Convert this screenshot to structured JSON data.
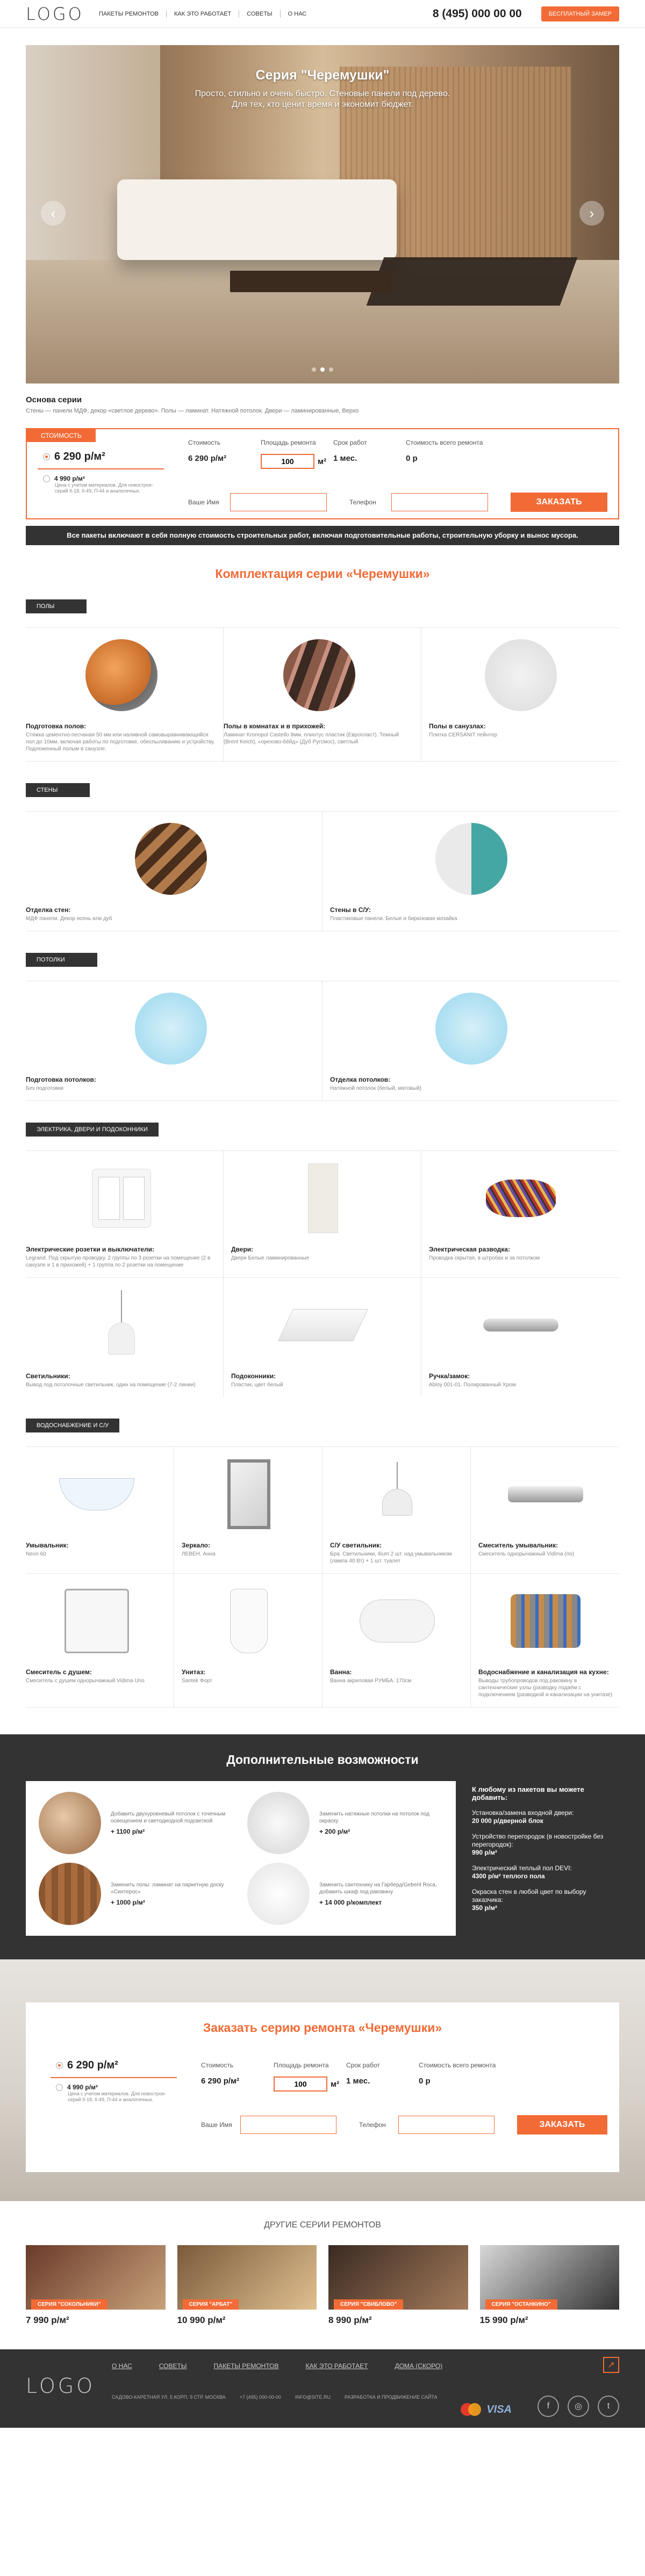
{
  "header": {
    "logo": "LOGO",
    "nav": [
      "Пакеты ремонтов",
      "Как это работает",
      "Советы",
      "О нас"
    ],
    "phone": "8 (495) 000 00 00",
    "cta": "Бесплатный замер"
  },
  "hero": {
    "title": "Серия \"Черемушки\"",
    "line1": "Просто, стильно и очень быстро. Стеновые панели под дерево.",
    "line2": "Для тех, кто ценит время и экономит бюджет.",
    "prev": "‹",
    "next": "›"
  },
  "series": {
    "title": "Основа серии",
    "desc": "Стены — панели МДФ, декор «светлое дерево». Полы — ламинат. Натяжной потолок. Двери — ламинированные, Верхо"
  },
  "calc": {
    "tab": "Стоимость",
    "price_main": "6 290 р/м²",
    "price_alt": "4 990 р/м²",
    "note_line1": "Цена с учетом материалов. Для новострое-",
    "note_line2": "серий II-18, II-49, П-44 и аналогичных.",
    "col1_label": "Стоимость",
    "col1_value": "6 290 р/м²",
    "col2_label": "Площадь ремонта",
    "col2_value": "100",
    "col2_unit": "м²",
    "col3_label": "Срок работ",
    "col3_value": "1 мес.",
    "col4_label": "Стоимость всего ремонта",
    "col4_value": "0 р",
    "name_label": "Ваше Имя",
    "phone_label": "Телефон",
    "order_button": "Заказать"
  },
  "banner": "Все пакеты включают в себя полную стоимость строительных работ, включая подготовительные работы, строительную уборку и вынос мусора.",
  "kit_title": "Комплектация серии «Черемушки»",
  "groups": {
    "floors": {
      "label": "Полы",
      "items": [
        {
          "title": "Подготовка полов:",
          "text": "Стяжка цементно-песчаная 50 мм или наливной самовыравнивающийся пол до 10мм, включая работы по подготовке, обеспыливанию и устройству. Подложенный полым в санузле."
        },
        {
          "title": "Полы в комнатах и в прихожей:",
          "text": "Ламинат Kronopol Castello 8мм, плинтус пластик (Европласт). Темный (Brent Keich), «орехово-бёйд» (Дуб Ругсмос), светлый"
        },
        {
          "title": "Полы в санузлах:",
          "text": "Плитка CERSANIT пейнтер"
        }
      ]
    },
    "walls": {
      "label": "Стены",
      "items": [
        {
          "title": "Отделка стен:",
          "text": "МДФ панели. Декор ясень или дуб"
        },
        {
          "title": "Стены в С/У:",
          "text": "Пластиковые панели. Белые и бирюзовая мозайка"
        }
      ]
    },
    "ceilings": {
      "label": "Потолки",
      "items": [
        {
          "title": "Подготовка потолков:",
          "text": "Без подготовки"
        },
        {
          "title": "Отделка потолков:",
          "text": "Натяжной потолок (белый, матовый)"
        }
      ]
    },
    "electric": {
      "label": "Электрика, двери и подоконники",
      "items": [
        {
          "title": "Электрические розетки и выключатели:",
          "text": "Legrand. Под скрытую проводку. 2 группы по 3 розетки на помещение (2 в санузле и 1 в прихожей) + 1 группа по 2 розетки на помещение"
        },
        {
          "title": "Двери:",
          "text": "Двери Белые ламинированные"
        },
        {
          "title": "Электрическая разводка:",
          "text": "Проводка скрытая, в штробах и за потолком"
        },
        {
          "title": "Светильники:",
          "text": "Вывод под потолочные светильник, один на помещение (7-2 линии)"
        },
        {
          "title": "Подоконники:",
          "text": "Пластик, цвет белый"
        },
        {
          "title": "Ручка/замок:",
          "text": "Abloy 001-01. Полированный Хром"
        }
      ]
    },
    "plumbing": {
      "label": "Водоснабжение и С/У",
      "items": [
        {
          "title": "Умывальник:",
          "text": "Neon 60"
        },
        {
          "title": "Зеркало:",
          "text": "ЛЕВЕН, Анна"
        },
        {
          "title": "С/У светильник:",
          "text": "Бра. Светильники, Ilium 2 шт. над умывальником (лампа 40 Вт) + 1 шт. туалет"
        },
        {
          "title": "Смеситель умывальник:",
          "text": "Смеситель однорычажный Vidima (по)"
        },
        {
          "title": "Смеситель с душем:",
          "text": "Смеситель с душем однорычажный Vidima Uno"
        },
        {
          "title": "Унитаз:",
          "text": "Santek Форт"
        },
        {
          "title": "Ванна:",
          "text": "Ванна акриловая РУМБА. 170см"
        },
        {
          "title": "Водоснабжение и канализация на кухне:",
          "text": "Выводы трубопроводов под раковину в сантехнические узлы (разводку подаём с подключением (разводкой и канализации на унитазе)"
        }
      ]
    }
  },
  "additional": {
    "title": "Дополнительные возможности",
    "items": [
      {
        "text": "Добавить двухуровневый потолок с точечным освещением и светодиодной подсветкой",
        "price": "+ 1100 р/м²"
      },
      {
        "text": "Заменить натяжные потолки на потолок под окраску",
        "price": "+ 200 р/м²"
      },
      {
        "text": "Заменить полы: ламинат на паркетную доску «Синтерос»",
        "price": "+ 1000 р/м²"
      },
      {
        "text": "Заменить сантехнику на Гарберд/Geberit Roca, добавить шкаф под раковину",
        "price": "+ 14 000 р/комплект"
      }
    ],
    "side_header": "К любому из пакетов вы можете добавить:",
    "side": [
      {
        "label": "Установка/замена входной двери:",
        "value": "20 000 р/дверной блок"
      },
      {
        "label": "Устройство перегородок (в новостройке без перегородок):",
        "value": "990 р/м²"
      },
      {
        "label": "Электрический теплый пол DEVI:",
        "value": "4300 р/м² теплого пола"
      },
      {
        "label": "Окраска стен в любой цвет по выбору заказчика:",
        "value": "350 р/м²"
      }
    ]
  },
  "order": {
    "title": "Заказать серию ремонта «Черемушки»"
  },
  "other": {
    "title": "Другие серии ремонтов",
    "cards": [
      {
        "badge": "Серия \"Сокольники\"",
        "price": "7 990 р/м²"
      },
      {
        "badge": "Серия \"Арбат\"",
        "price": "10 990 р/м²"
      },
      {
        "badge": "Серия \"Свиблово\"",
        "price": "8 990 р/м²"
      },
      {
        "badge": "Серия \"Останкино\"",
        "price": "15 990 р/м²"
      }
    ]
  },
  "footer": {
    "logo": "LOGO",
    "nav": [
      "О нас",
      "Советы",
      "Пакеты ремонтов",
      "Как это работает",
      "Дома (СКОРО)"
    ],
    "addr": [
      "САДОВО-КАРЕТНАЯ УЛ. 5 КОРП. 9 СТР. МОСКВА",
      "+7 (495) 000-00-00",
      "INFO@SITE.RU",
      "РАЗРАБОТКА И ПРОДВИЖЕНИЕ САЙТА"
    ],
    "up": "↗",
    "visa": "VISA",
    "soc": [
      "f",
      "◎",
      "t"
    ]
  }
}
